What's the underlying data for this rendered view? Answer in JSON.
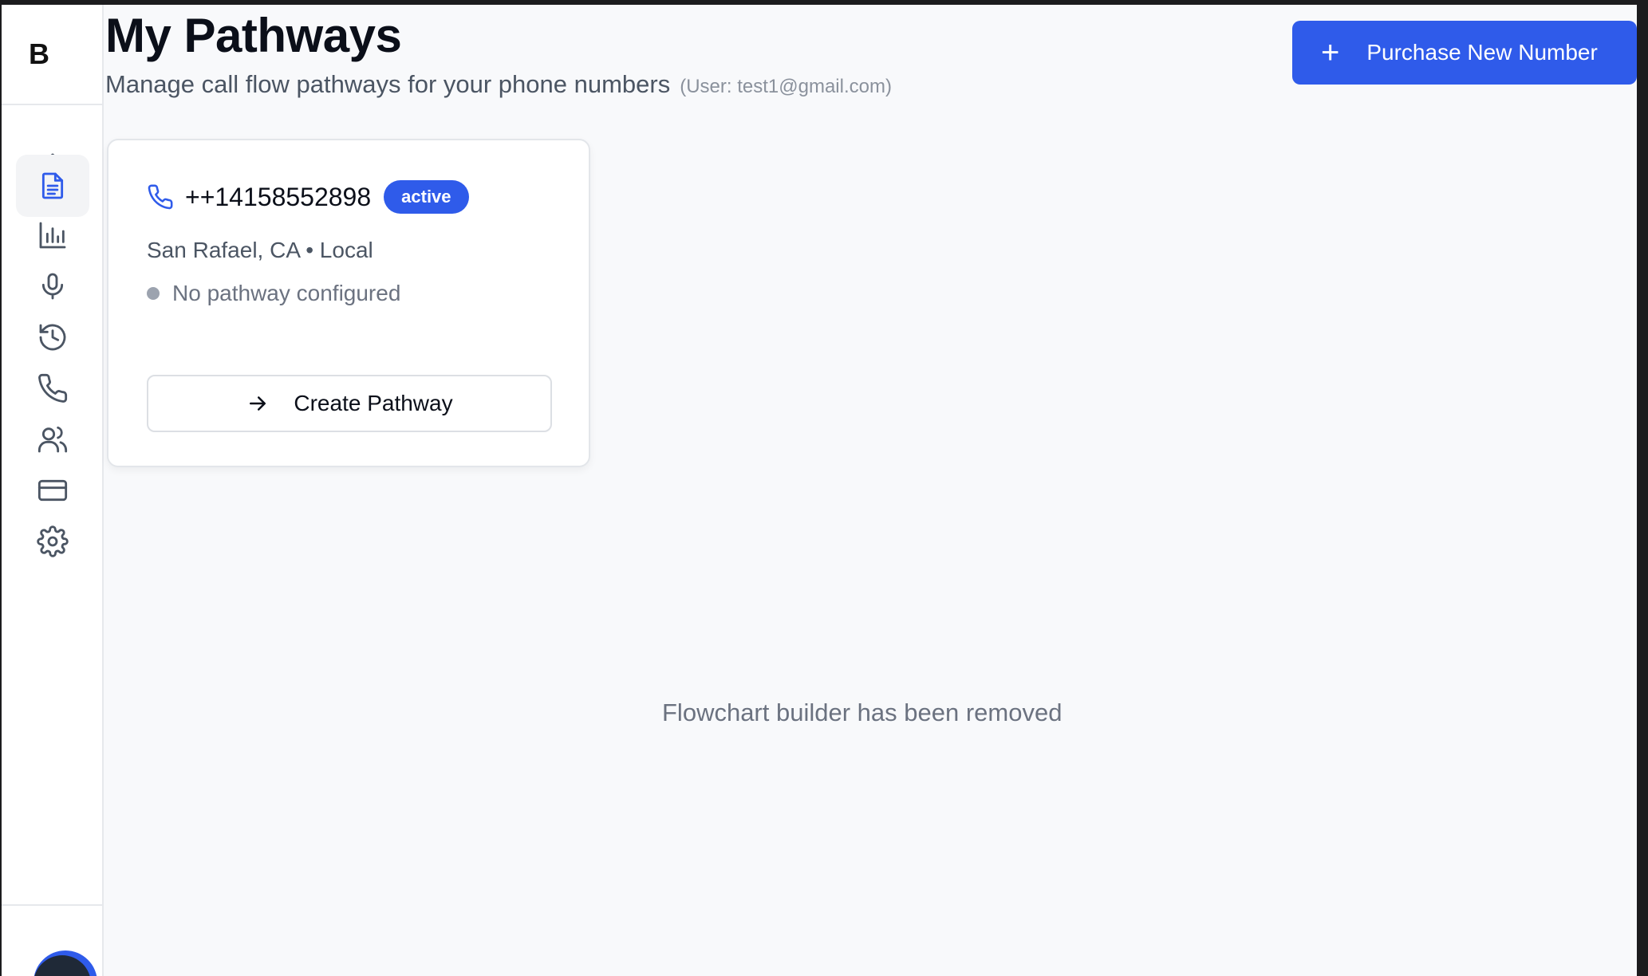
{
  "sidebar": {
    "logo": "B",
    "nav": [
      {
        "icon": "home-icon",
        "active": false
      },
      {
        "icon": "document-icon",
        "active": true
      },
      {
        "icon": "bar-chart-icon",
        "active": false
      },
      {
        "icon": "microphone-icon",
        "active": false
      },
      {
        "icon": "history-icon",
        "active": false
      },
      {
        "icon": "phone-icon",
        "active": false
      },
      {
        "icon": "users-icon",
        "active": false
      },
      {
        "icon": "credit-card-icon",
        "active": false
      },
      {
        "icon": "gear-icon",
        "active": false
      }
    ]
  },
  "header": {
    "title": "My Pathways",
    "subtitle": "Manage call flow pathways for your phone numbers",
    "user_note": "(User: test1@gmail.com)",
    "purchase_label": "Purchase New Number"
  },
  "card": {
    "phone_number": "++14158552898",
    "status": "active",
    "location": "San Rafael, CA • Local",
    "pathway_status": "No pathway configured",
    "create_label": "Create Pathway"
  },
  "main": {
    "message": "Flowchart builder has been removed"
  },
  "colors": {
    "accent": "#2f5bea",
    "background": "#f8f9fb"
  }
}
